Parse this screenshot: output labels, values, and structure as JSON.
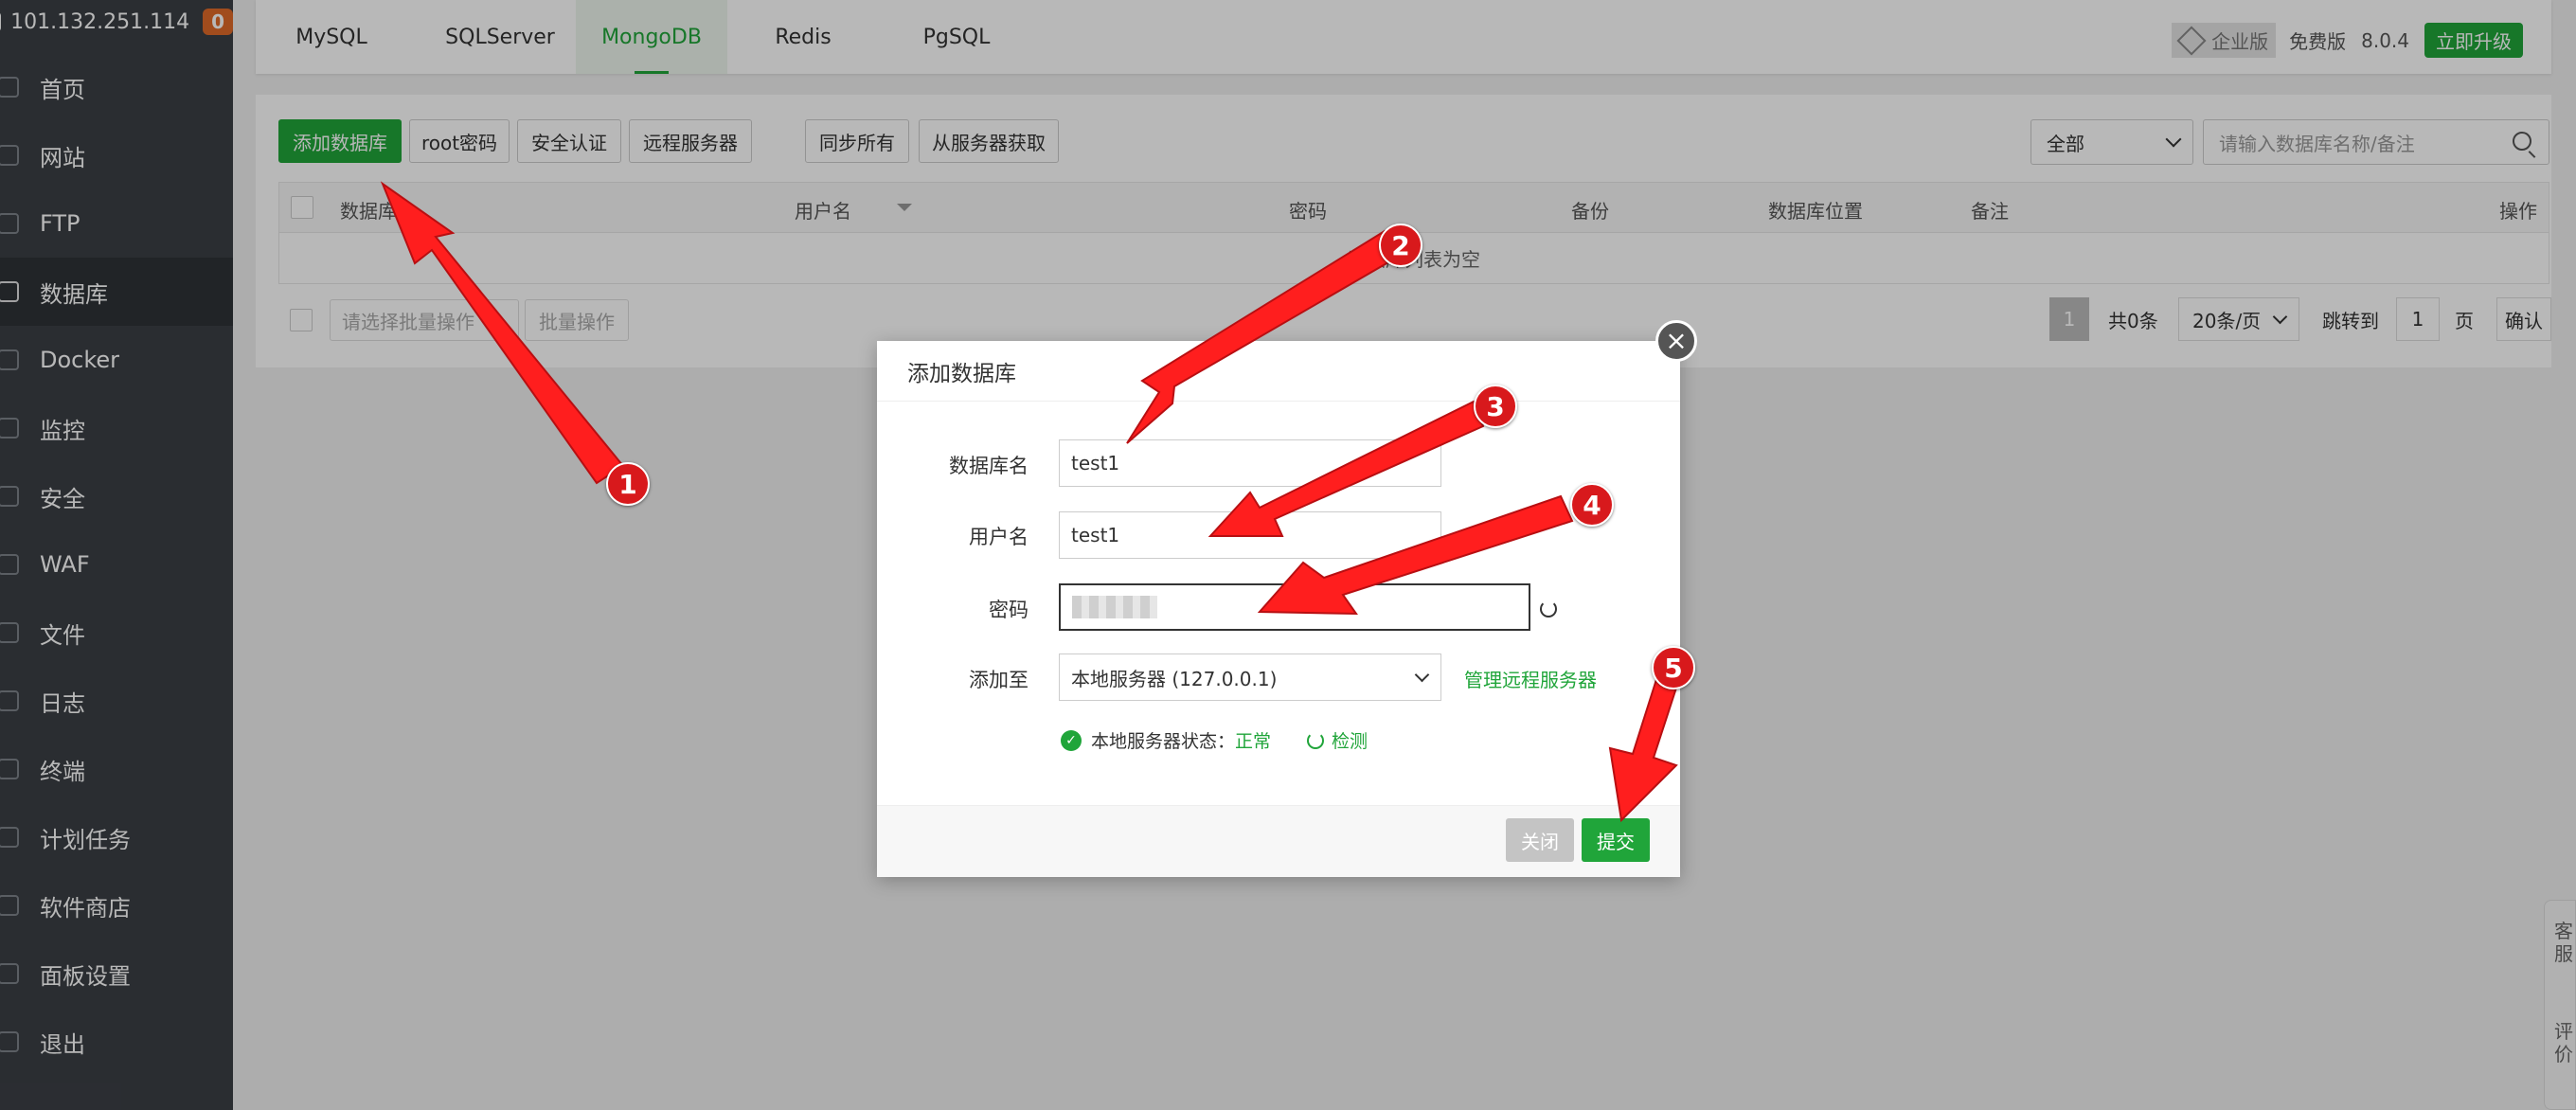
{
  "server": {
    "ip": "101.132.251.114",
    "badge": "0"
  },
  "sidebar": {
    "items": [
      {
        "label": "首页",
        "icon": "home-icon"
      },
      {
        "label": "网站",
        "icon": "globe-icon"
      },
      {
        "label": "FTP",
        "icon": "ftp-icon"
      },
      {
        "label": "数据库",
        "icon": "database-icon",
        "active": true
      },
      {
        "label": "Docker",
        "icon": "docker-icon"
      },
      {
        "label": "监控",
        "icon": "monitor-icon"
      },
      {
        "label": "安全",
        "icon": "shield-icon"
      },
      {
        "label": "WAF",
        "icon": "waf-icon"
      },
      {
        "label": "文件",
        "icon": "folder-icon"
      },
      {
        "label": "日志",
        "icon": "log-icon"
      },
      {
        "label": "终端",
        "icon": "terminal-icon"
      },
      {
        "label": "计划任务",
        "icon": "calendar-icon"
      },
      {
        "label": "软件商店",
        "icon": "apps-icon"
      },
      {
        "label": "面板设置",
        "icon": "gear-icon"
      },
      {
        "label": "退出",
        "icon": "logout-icon"
      }
    ]
  },
  "tabs": [
    "MySQL",
    "SQLServer",
    "MongoDB",
    "Redis",
    "PgSQL"
  ],
  "active_tab": "MongoDB",
  "top_right": {
    "enterprise": "企业版",
    "free": "免费版",
    "version": "8.0.4",
    "upgrade": "立即升级"
  },
  "toolbar": {
    "add_db": "添加数据库",
    "root_pwd": "root密码",
    "security_auth": "安全认证",
    "remote_server": "远程服务器",
    "sync_all": "同步所有",
    "fetch_from_server": "从服务器获取",
    "filter_all": "全部",
    "search_placeholder": "请输入数据库名称/备注"
  },
  "table": {
    "headers": [
      "数据库名",
      "用户名",
      "密码",
      "备份",
      "数据库位置",
      "备注",
      "操作"
    ],
    "empty_text": "数据库列表为空"
  },
  "bulk": {
    "select_placeholder": "请选择批量操作",
    "button": "批量操作"
  },
  "pager": {
    "current": "1",
    "total": "共0条",
    "per_page": "20条/页",
    "jump_to": "跳转到",
    "jump_value": "1",
    "page_unit": "页",
    "confirm": "确认"
  },
  "dialog": {
    "title": "添加数据库",
    "db_name_label": "数据库名",
    "db_name_value": "test1",
    "username_label": "用户名",
    "username_value": "test1",
    "password_label": "密码",
    "add_to_label": "添加至",
    "add_to_value": "本地服务器 (127.0.0.1)",
    "manage_remote": "管理远程服务器",
    "status_label": "本地服务器状态：",
    "status_value": "正常",
    "detect": "检测",
    "close_btn": "关闭",
    "submit_btn": "提交"
  },
  "annotations": [
    "1",
    "2",
    "3",
    "4",
    "5"
  ],
  "side_widget": {
    "service": "客服",
    "review": "评价"
  },
  "colors": {
    "brand_green": "#20a53a",
    "sidebar_bg": "#3b3f45",
    "annotation_red": "#d8191c"
  }
}
